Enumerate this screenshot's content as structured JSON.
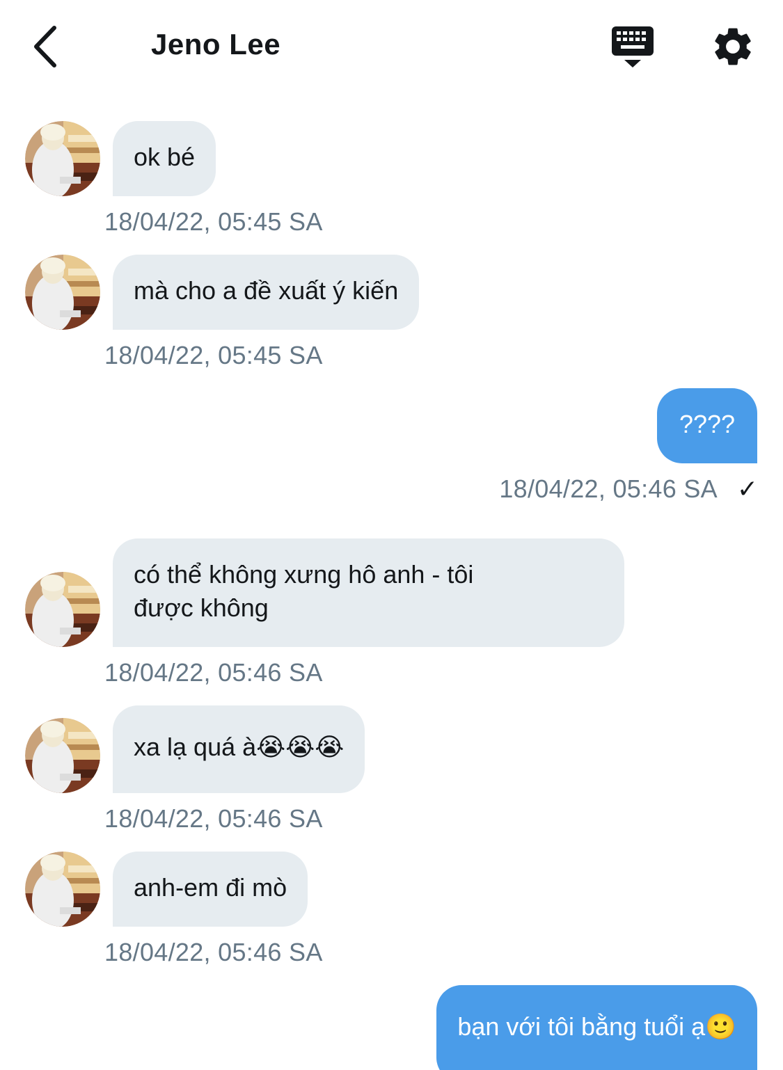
{
  "header": {
    "title": "Jeno Lee",
    "back_icon": "chevron-left-icon",
    "keyboard_icon": "keyboard-icon",
    "settings_icon": "gear-icon"
  },
  "colors": {
    "incoming_bubble": "#e6ecf0",
    "outgoing_bubble": "#4a9ce9",
    "timestamp": "#657786"
  },
  "messages": [
    {
      "direction": "in",
      "text": "ok bé",
      "time": "18/04/22, 05:45 SA"
    },
    {
      "direction": "in",
      "text": "mà cho a đề xuất ý kiến",
      "time": "18/04/22, 05:45 SA"
    },
    {
      "direction": "out",
      "text": "????",
      "time": "18/04/22, 05:46 SA",
      "status": "✓"
    },
    {
      "direction": "in",
      "text_line1": "có thể không xưng hô anh - tôi",
      "text_line2": "được không",
      "time": "18/04/22, 05:46 SA"
    },
    {
      "direction": "in",
      "text": "xa lạ quá à😭😭😭",
      "time": "18/04/22, 05:46 SA"
    },
    {
      "direction": "in",
      "text": "anh-em đi mò",
      "time": "18/04/22, 05:46 SA"
    },
    {
      "direction": "out",
      "text": "bạn với tôi bằng tuổi ạ🙂"
    }
  ]
}
